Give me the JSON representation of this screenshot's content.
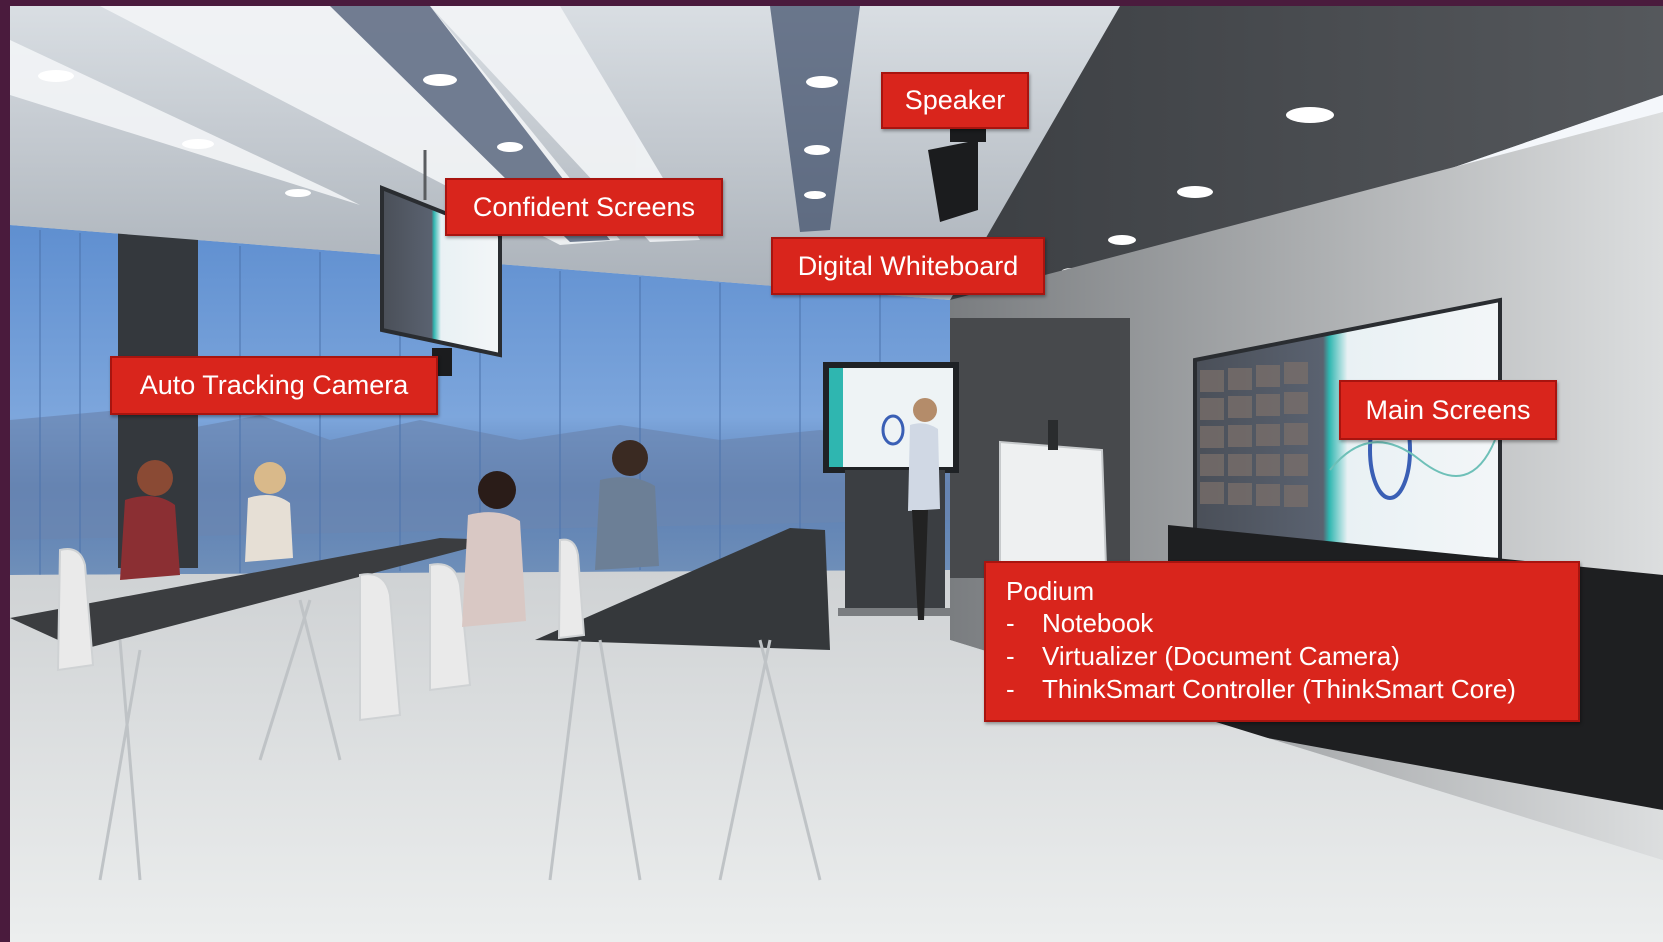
{
  "labels": {
    "speaker": "Speaker",
    "confident_screens": "Confident Screens",
    "digital_whiteboard": "Digital Whiteboard",
    "auto_tracking_camera": "Auto Tracking Camera",
    "main_screens": "Main Screens"
  },
  "podium": {
    "title": "Podium",
    "items": [
      {
        "bullet": "-",
        "text": "Notebook"
      },
      {
        "bullet": "-",
        "text": "Virtualizer (Document Camera)"
      },
      {
        "bullet": "-",
        "text": "ThinkSmart Controller (ThinkSmart Core)"
      }
    ]
  },
  "colors": {
    "label_background": "#d9251c",
    "label_text": "#ffffff",
    "frame": "#4a1b3d"
  }
}
